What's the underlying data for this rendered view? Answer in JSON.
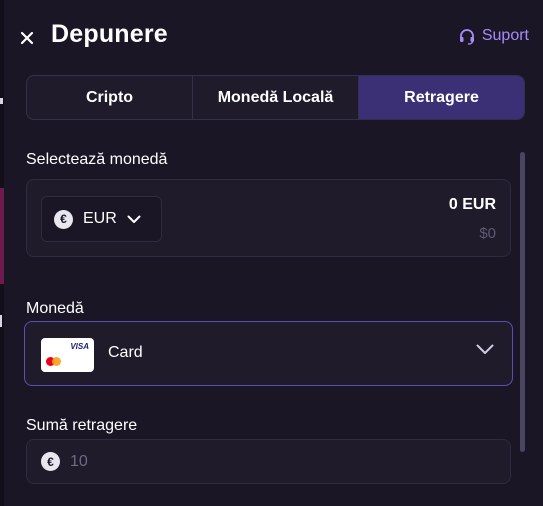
{
  "header": {
    "title": "Depunere",
    "support_label": "Suport"
  },
  "tabs": [
    {
      "label": "Cripto",
      "active": false
    },
    {
      "label": "Monedă Locală",
      "active": false
    },
    {
      "label": "Retragere",
      "active": true
    }
  ],
  "currency_section": {
    "label": "Selectează monedă",
    "selected_currency": "EUR",
    "coin_symbol": "€",
    "amount": "0 EUR",
    "amount_usd": "$0"
  },
  "method_section": {
    "label": "Monedă",
    "selected_method": "Card",
    "card_brand_text": "VISA"
  },
  "withdraw_section": {
    "label": "Sumă retragere",
    "coin_symbol": "€",
    "placeholder": "10"
  },
  "colors": {
    "background": "#1a1626",
    "panel": "#1f1b2b",
    "accent": "#a78bfa",
    "active_tab": "#3b2f75",
    "focus_border": "#5b4fb0"
  }
}
